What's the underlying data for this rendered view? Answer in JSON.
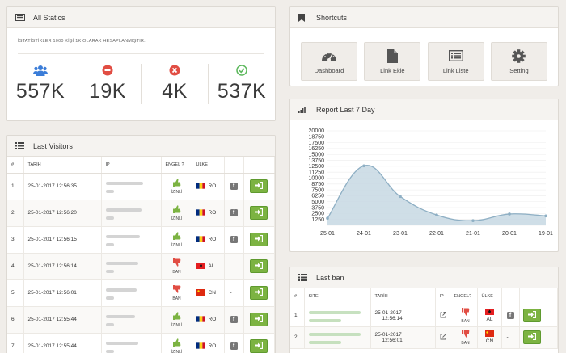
{
  "statics": {
    "title": "All Statics",
    "note": "İSTATİSTİKLER 1000 KİŞİ 1K OLARAK HESAPLANMIŞTIR.",
    "items": [
      {
        "icon": "users-icon",
        "value": "557K",
        "color": "#3b7dd8"
      },
      {
        "icon": "minus-circle-icon",
        "value": "19K",
        "color": "#e14d43"
      },
      {
        "icon": "x-circle-icon",
        "value": "4K",
        "color": "#e14d43"
      },
      {
        "icon": "check-circle-icon",
        "value": "537K",
        "color": "#5cb85c"
      }
    ]
  },
  "shortcuts": {
    "title": "Shortcuts",
    "buttons": [
      {
        "label": "Dashboard",
        "icon": "dashboard-icon"
      },
      {
        "label": "Link Ekle",
        "icon": "file-icon"
      },
      {
        "label": "Link Liste",
        "icon": "list-icon"
      },
      {
        "label": "Setting",
        "icon": "gear-icon"
      }
    ]
  },
  "report": {
    "title": "Report Last 7 Day",
    "fill": "#c7d8e3",
    "stroke": "#8eafc4"
  },
  "chart_data": {
    "type": "area",
    "categories": [
      "25-01",
      "24-01",
      "23-01",
      "22-01",
      "21-01",
      "20-01",
      "19-01"
    ],
    "values": [
      1500,
      12600,
      6100,
      2200,
      1000,
      2400,
      2000
    ],
    "yticks": [
      1250,
      2500,
      3750,
      5000,
      6250,
      7500,
      8750,
      10000,
      11250,
      12500,
      13750,
      15000,
      16250,
      17500,
      18750,
      20000
    ],
    "ylim": [
      0,
      20000
    ],
    "grid": true
  },
  "visitors": {
    "title": "Last Visitors",
    "columns": [
      "#",
      "TARİH",
      "IP",
      "ENGEL ?",
      "ÜLKE",
      "",
      ""
    ],
    "rows": [
      {
        "n": "1",
        "date": "25-01-2017 12:56:35",
        "status": "İZİNLİ",
        "country": "RO"
      },
      {
        "n": "2",
        "date": "25-01-2017 12:56:20",
        "status": "İZİNLİ",
        "country": "RO"
      },
      {
        "n": "3",
        "date": "25-01-2017 12:56:15",
        "status": "İZİNLİ",
        "country": "RO"
      },
      {
        "n": "4",
        "date": "25-01-2017 12:56:14",
        "status": "BAN",
        "country": "AL"
      },
      {
        "n": "5",
        "date": "25-01-2017 12:56:01",
        "status": "BAN",
        "country": "CN"
      },
      {
        "n": "6",
        "date": "25-01-2017 12:55:44",
        "status": "İZİNLİ",
        "country": "RO"
      },
      {
        "n": "7",
        "date": "25-01-2017 12:55:44",
        "status": "İZİNLİ",
        "country": "RO"
      }
    ]
  },
  "ban": {
    "title": "Last ban",
    "columns": [
      "#",
      "SITE",
      "TARİH",
      "IP",
      "ENGEL?",
      "ÜLKE",
      "",
      ""
    ],
    "rows": [
      {
        "n": "1",
        "date": "25-01-2017",
        "time": "12:56:14",
        "status": "BAN",
        "country": "AL"
      },
      {
        "n": "2",
        "date": "25-01-2017",
        "time": "12:56:01",
        "status": "BAN",
        "country": "CN"
      }
    ],
    "dash": "-"
  },
  "colors": {
    "thumb_up": "#7cb342",
    "thumb_down": "#e14d43",
    "action_green": "#7cb342"
  }
}
